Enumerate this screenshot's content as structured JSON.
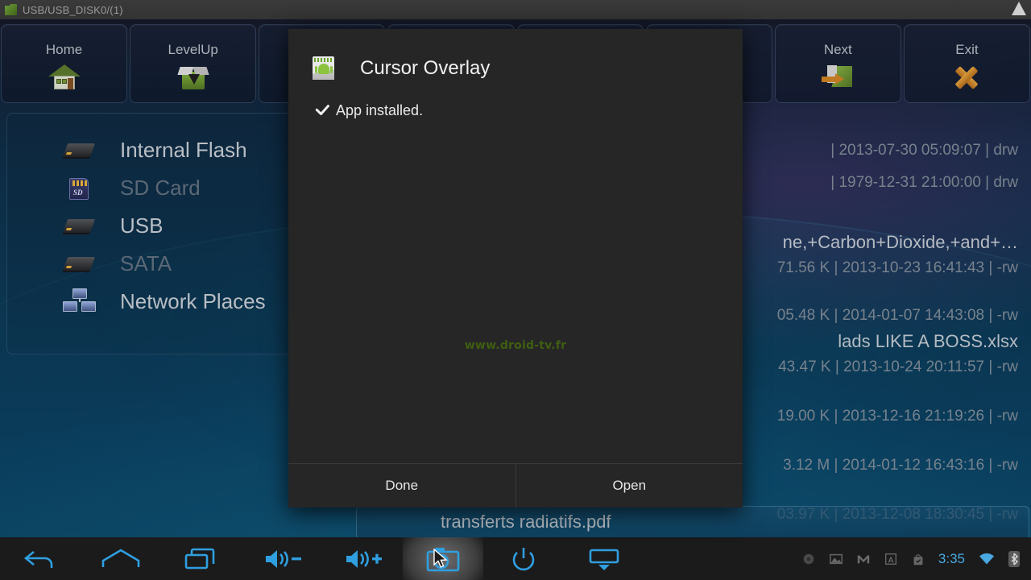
{
  "titlebar": {
    "path": "USB/USB_DISK0/(1)",
    "folder_icon": "folder-icon",
    "scroll_up_icon": "scroll-up-arrow-icon"
  },
  "toolbar": {
    "buttons": [
      {
        "label": "Home",
        "icon": "home-icon"
      },
      {
        "label": "LevelUp",
        "icon": "level-up-box-icon"
      },
      {
        "label": "",
        "icon": ""
      },
      {
        "label": "",
        "icon": ""
      },
      {
        "label": "",
        "icon": ""
      },
      {
        "label": "",
        "icon": ""
      },
      {
        "label": "Next",
        "icon": "next-folder-icon"
      },
      {
        "label": "Exit",
        "icon": "exit-cross-icon"
      }
    ]
  },
  "sidebar": {
    "items": [
      {
        "label": "Internal Flash",
        "icon": "drive-icon",
        "enabled": true
      },
      {
        "label": "SD Card",
        "icon": "sd-card-icon",
        "enabled": false
      },
      {
        "label": "USB",
        "icon": "drive-icon",
        "enabled": true
      },
      {
        "label": "SATA",
        "icon": "drive-icon",
        "enabled": false
      },
      {
        "label": "Network Places",
        "icon": "network-places-icon",
        "enabled": true
      }
    ]
  },
  "filelist": {
    "rows": [
      {
        "name": "",
        "meta": "| 2013-07-30 05:09:07 | drw",
        "selected": false
      },
      {
        "name": "",
        "meta": "| 1979-12-31 21:00:00 | drw",
        "selected": false
      },
      {
        "name": "ne,+Carbon+Dioxide,+and+…",
        "meta": "71.56 K | 2013-10-23 16:41:43 | -rw",
        "selected": false
      },
      {
        "name": "",
        "meta": "05.48 K | 2014-01-07 14:43:08 | -rw",
        "selected": false
      },
      {
        "name": "lads LIKE A BOSS.xlsx",
        "meta": "43.47 K | 2013-10-24 20:11:57 | -rw",
        "selected": false
      },
      {
        "name": "",
        "meta": "19.00 K | 2013-12-16 21:19:26 | -rw",
        "selected": false
      },
      {
        "name": "",
        "meta": "3.12 M | 2014-01-12 16:43:16 | -rw",
        "selected": false
      },
      {
        "name": "",
        "meta": "03.97 K | 2013-12-08 18:30:45 | -rw",
        "selected": false
      },
      {
        "name": "transferts radiatifs.pdf",
        "meta": "",
        "selected": true
      }
    ]
  },
  "dialog": {
    "app_icon": "android-app-icon",
    "title": "Cursor Overlay",
    "status_icon": "checkmark-icon",
    "status_text": "App installed.",
    "watermark": "www.droid-tv.fr",
    "buttons": [
      {
        "label": "Done"
      },
      {
        "label": "Open"
      }
    ]
  },
  "navbar": {
    "buttons": [
      {
        "name": "back-icon",
        "active": false
      },
      {
        "name": "home-icon",
        "active": false
      },
      {
        "name": "recents-icon",
        "active": false
      },
      {
        "name": "volume-down-icon",
        "active": false
      },
      {
        "name": "volume-up-icon",
        "active": false
      },
      {
        "name": "screenshot-icon",
        "active": true
      },
      {
        "name": "power-icon",
        "active": false
      },
      {
        "name": "display-icon",
        "active": false
      }
    ],
    "status": {
      "icons": [
        "record-icon",
        "image-icon",
        "gmail-icon",
        "font-icon",
        "shopping-bag-check-icon"
      ],
      "clock": "3:35",
      "wifi_icon": "wifi-icon",
      "bluetooth_icon": "bluetooth-icon"
    }
  },
  "colors": {
    "accent_blue": "#2f9fe0",
    "dialog_bg": "#262626",
    "watermark_green": "#3f5e12",
    "exit_orange": "#c07a22"
  }
}
